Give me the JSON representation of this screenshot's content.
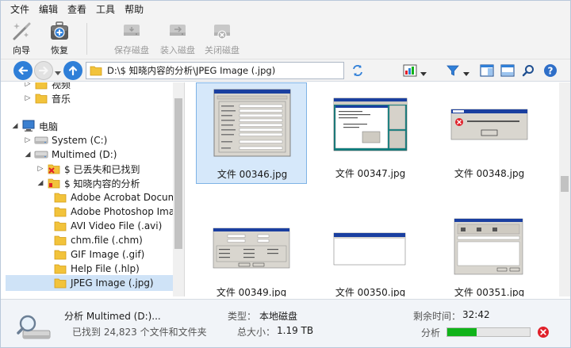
{
  "menu": [
    "文件",
    "编辑",
    "查看",
    "工具",
    "帮助"
  ],
  "toolbar": {
    "wizard": "向导",
    "recover": "恢复",
    "save_disk": "保存磁盘",
    "mount_disk": "装入磁盘",
    "close_disk": "关闭磁盘"
  },
  "address": {
    "path": "D:\\$ 知晓内容的分析\\JPEG Image (.jpg)"
  },
  "tree": [
    {
      "label": "视频",
      "indent": 1
    },
    {
      "label": "音乐",
      "indent": 1
    },
    {
      "label": "电脑",
      "indent": 0
    },
    {
      "label": "System (C:)",
      "indent": 1
    },
    {
      "label": "Multimed (D:)",
      "indent": 1
    },
    {
      "label": "$ 已丢失和已找到",
      "indent": 2
    },
    {
      "label": "$ 知晓内容的分析",
      "indent": 2
    },
    {
      "label": "Adobe Acrobat Document",
      "indent": 3
    },
    {
      "label": "Adobe Photoshop Image",
      "indent": 3
    },
    {
      "label": "AVI Video File (.avi)",
      "indent": 3
    },
    {
      "label": "chm.file (.chm)",
      "indent": 3
    },
    {
      "label": "GIF Image (.gif)",
      "indent": 3
    },
    {
      "label": "Help File (.hlp)",
      "indent": 3
    },
    {
      "label": "JPEG Image (.jpg)",
      "indent": 3
    }
  ],
  "files": [
    {
      "name": "文件 00346.jpg"
    },
    {
      "name": "文件 00347.jpg"
    },
    {
      "name": "文件 00348.jpg"
    },
    {
      "name": "文件 00349.jpg"
    },
    {
      "name": "文件 00350.jpg"
    },
    {
      "name": "文件 00351.jpg"
    }
  ],
  "status": {
    "analyzing": "分析 Multimed (D:)...",
    "found": "已找到 24,823 个文件和文件夹",
    "type_label": "类型：",
    "type_value": "本地磁盘",
    "size_label": "总大小：",
    "size_value": "1.19 TB",
    "time_label": "剩余时间：",
    "time_value": "32:42",
    "progress_label": "分析",
    "progress_value": 0.36
  },
  "colors": {
    "accent": "#2f7fd8",
    "progress": "#10b31a",
    "stop": "#e0202a"
  }
}
